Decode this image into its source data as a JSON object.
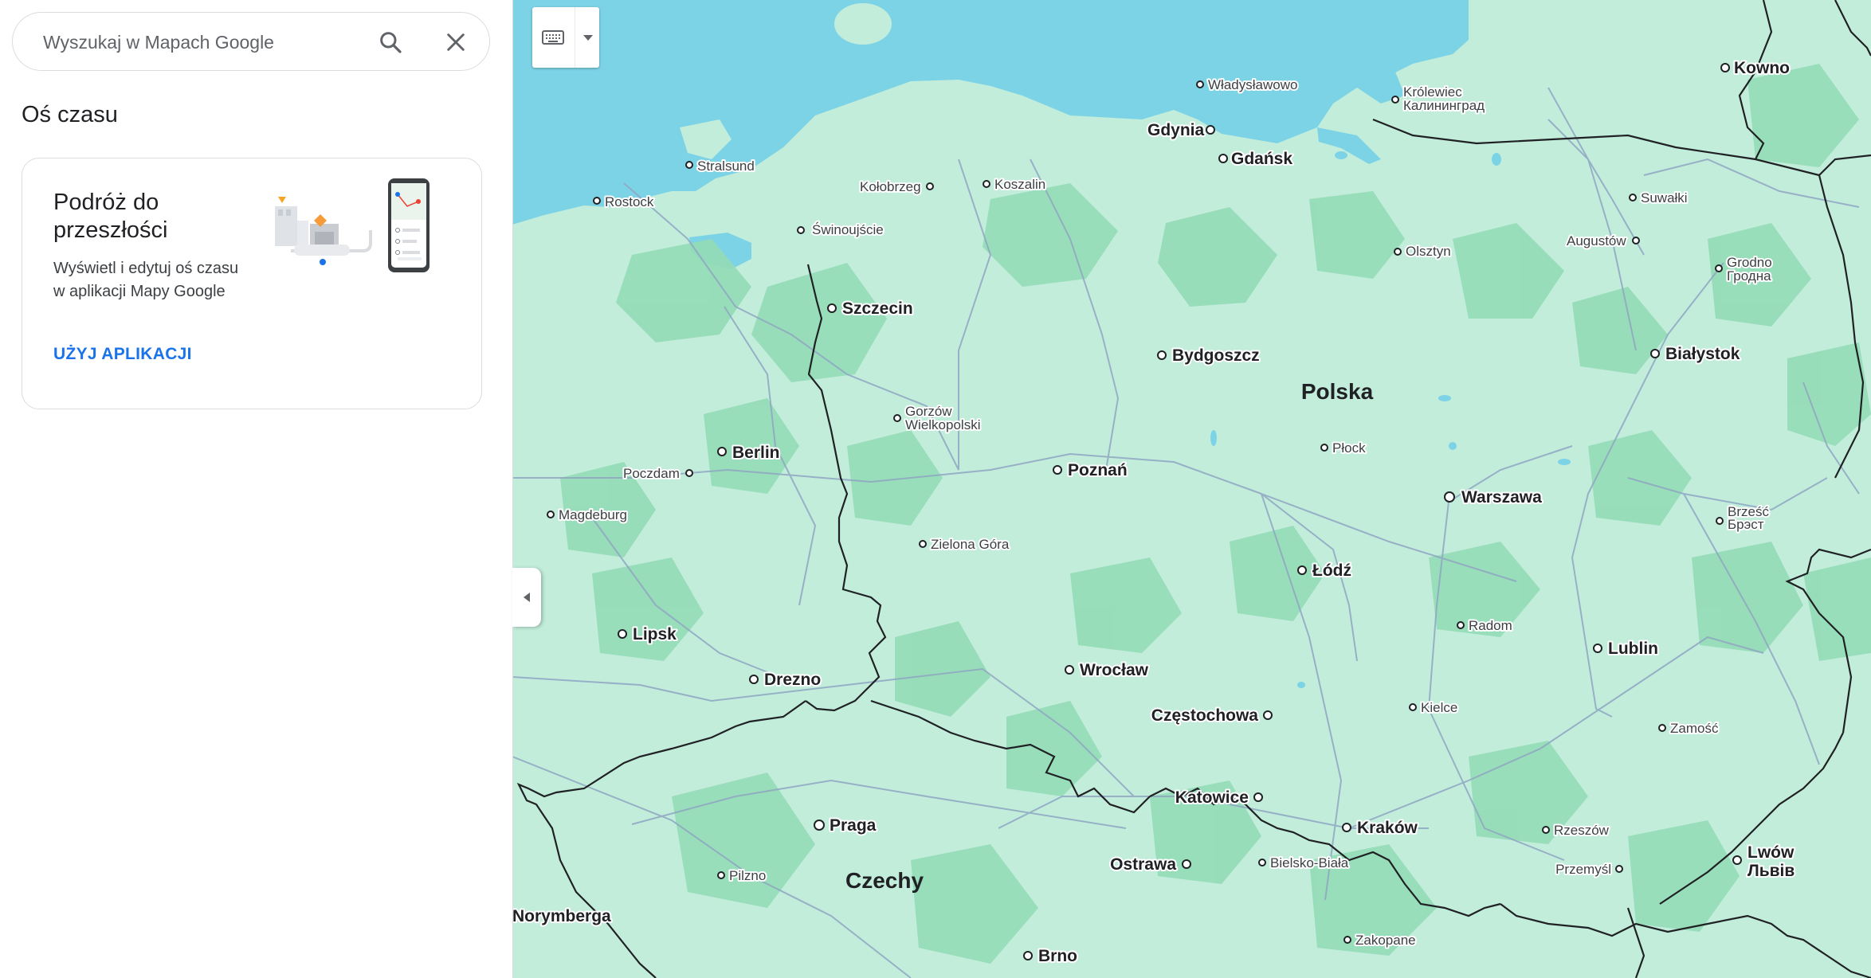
{
  "search": {
    "placeholder": "Wyszukaj w Mapach Google"
  },
  "panel": {
    "timeline_title": "Oś czasu",
    "card": {
      "title": "Podróż do przeszłości",
      "description": "Wyświetl i edytuj oś czasu w aplikacji Mapy Google",
      "cta": "UŻYJ APLIKACJI"
    }
  },
  "colors": {
    "water": "#7dd3e6",
    "land": "#c2eddb",
    "forest": "#94dcb6",
    "road": "#8fa6c2",
    "border": "#202124",
    "accent": "#1a73e8"
  },
  "icons": {
    "search": "search-icon",
    "clear": "close-icon",
    "keyboard": "keyboard-icon",
    "arrow": "triangle-down-icon",
    "collapse": "chevron-left-icon"
  },
  "map": {
    "countries": [
      "Polska",
      "Czechy"
    ],
    "cities": [
      "Władysławowo",
      "Królewiec",
      "Калининград",
      "Kowno",
      "Gdynia",
      "Gdańsk",
      "Stralsund",
      "Kołobrzeg",
      "Koszalin",
      "Rostock",
      "Świnoujście",
      "Suwałki",
      "Augustów",
      "Olsztyn",
      "Grodno",
      "Гродна",
      "Szczecin",
      "Bydgoszcz",
      "Białystok",
      "Gorzów",
      "Wielkopolski",
      "Berlin",
      "Poczdam",
      "Poznań",
      "Płock",
      "Warszawa",
      "Magdeburg",
      "Zielona Góra",
      "Łódź",
      "Brześć",
      "Брэст",
      "Lipsk",
      "Radom",
      "Lublin",
      "Drezno",
      "Wrocław",
      "Kielce",
      "Częstochowa",
      "Zamość",
      "Katowice",
      "Praga",
      "Kraków",
      "Rzeszów",
      "Ostrawa",
      "Bielsko-Biała",
      "Przemyśl",
      "Lwów",
      "Львів",
      "Pilzno",
      "Norymberga",
      "Zakopane",
      "Brno"
    ]
  }
}
